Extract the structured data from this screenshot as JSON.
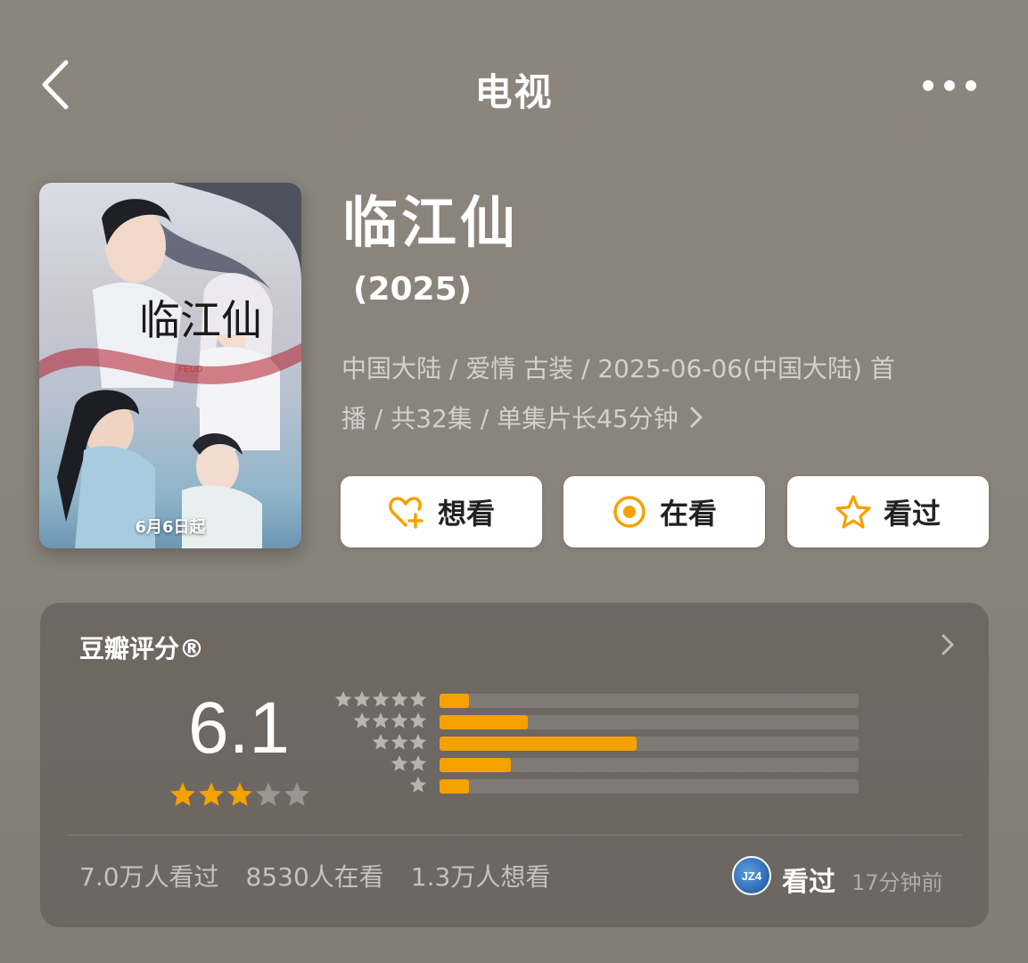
{
  "header": {
    "title": "电视",
    "back_icon": "chevron-left-icon",
    "more_icon": "more-dots-icon"
  },
  "poster": {
    "date_text": "6月6日起",
    "overlay_title": "临江仙",
    "overlay_en": "FEUD"
  },
  "show": {
    "title": "临江仙",
    "year": "(2025)",
    "meta_line1": "中国大陆 / 爱情 古装 / 2025-06-06(中国大陆) 首",
    "meta_line2": "播 / 共32集 / 单集片长45分钟"
  },
  "actions": [
    {
      "label": "想看",
      "icon": "heart-plus-icon"
    },
    {
      "label": "在看",
      "icon": "target-circle-icon"
    },
    {
      "label": "看过",
      "icon": "star-outline-icon"
    }
  ],
  "rating": {
    "title": "豆瓣评分®",
    "score": "6.1",
    "stars_filled": 3,
    "stars_total": 5,
    "distribution": [
      {
        "stars": 5,
        "fraction": 0.07
      },
      {
        "stars": 4,
        "fraction": 0.21
      },
      {
        "stars": 3,
        "fraction": 0.47
      },
      {
        "stars": 2,
        "fraction": 0.17
      },
      {
        "stars": 1,
        "fraction": 0.07
      }
    ],
    "stats": [
      "7.0万人看过",
      "8530人在看",
      "1.3万人想看"
    ],
    "user_avatar_text": "JZ4",
    "user_status": "看过",
    "user_time": "17分钟前"
  },
  "colors": {
    "accent": "#f5a100",
    "star_empty": "#9a9590",
    "background": "#8a847c"
  }
}
